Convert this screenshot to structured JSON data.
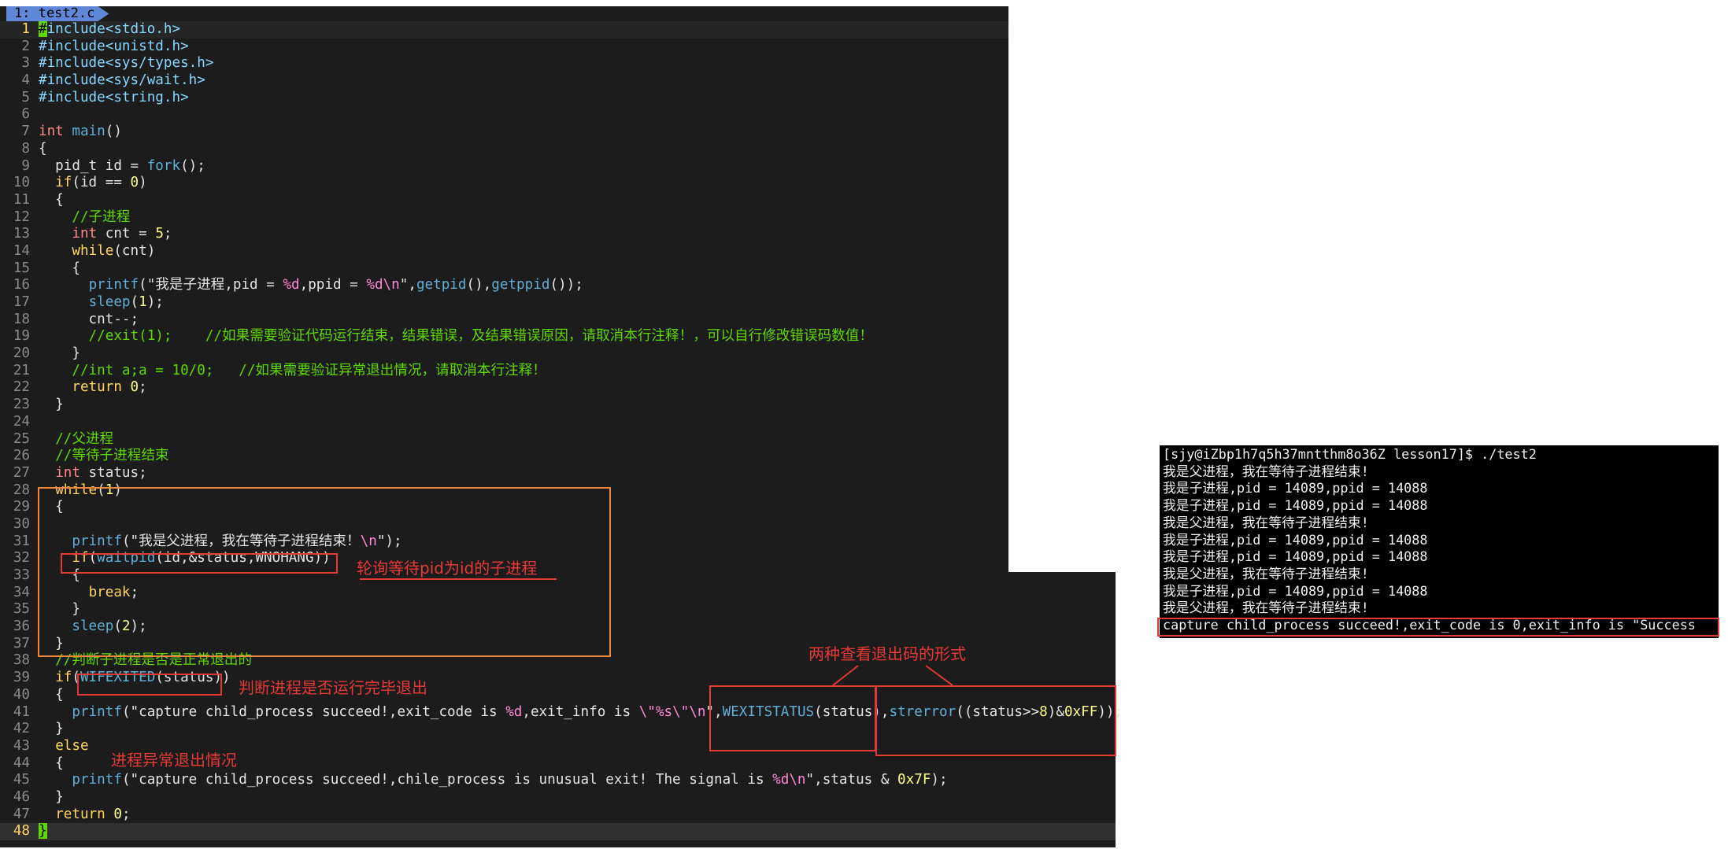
{
  "tab": {
    "label": "1: test2.c"
  },
  "editor": {
    "lines": [
      {
        "n": "1",
        "html": "<span class=\"cursor\">#</span><span class=\"pp\">include&lt;stdio.h&gt;</span>"
      },
      {
        "n": "2",
        "html": "<span class=\"pp\">#include&lt;unistd.h&gt;</span>"
      },
      {
        "n": "3",
        "html": "<span class=\"pp\">#include&lt;sys/types.h&gt;</span>"
      },
      {
        "n": "4",
        "html": "<span class=\"pp\">#include&lt;sys/wait.h&gt;</span>"
      },
      {
        "n": "5",
        "html": "<span class=\"pp\">#include&lt;string.h&gt;</span>"
      },
      {
        "n": "6",
        "html": ""
      },
      {
        "n": "7",
        "html": "<span class=\"ty\">int</span> <span class=\"fn\">main</span>()"
      },
      {
        "n": "8",
        "html": "{"
      },
      {
        "n": "9",
        "html": "  pid_t id = <span class=\"fn\">fork</span>();"
      },
      {
        "n": "10",
        "html": "  <span class=\"kw\">if</span>(id == <span class=\"num\">0</span>)"
      },
      {
        "n": "11",
        "html": "  {"
      },
      {
        "n": "12",
        "html": "    <span class=\"cm\">//子进程</span>"
      },
      {
        "n": "13",
        "html": "    <span class=\"ty\">int</span> cnt = <span class=\"num\">5</span>;"
      },
      {
        "n": "14",
        "html": "    <span class=\"kw\">while</span>(cnt)"
      },
      {
        "n": "15",
        "html": "    {"
      },
      {
        "n": "16",
        "html": "      <span class=\"fn\">printf</span>(\"我是子进程,pid = <span class=\"esc\">%d</span>,ppid = <span class=\"esc\">%d\\n</span>\",<span class=\"fn\">getpid</span>(),<span class=\"fn\">getppid</span>());"
      },
      {
        "n": "17",
        "html": "      <span class=\"fn\">sleep</span>(<span class=\"num\">1</span>);"
      },
      {
        "n": "18",
        "html": "      cnt--;"
      },
      {
        "n": "19",
        "html": "      <span class=\"cm\">//exit(1);    //如果需要验证代码运行结束，结果错误，及结果错误原因，请取消本行注释！，可以自行修改错误码数值！</span>"
      },
      {
        "n": "20",
        "html": "    }"
      },
      {
        "n": "21",
        "html": "    <span class=\"cm\">//int a;a = 10/0;   //如果需要验证异常退出情况，请取消本行注释！</span>"
      },
      {
        "n": "22",
        "html": "    <span class=\"kw\">return</span> <span class=\"num\">0</span>;"
      },
      {
        "n": "23",
        "html": "  }"
      },
      {
        "n": "24",
        "html": ""
      },
      {
        "n": "25",
        "html": "  <span class=\"cm\">//父进程</span>"
      },
      {
        "n": "26",
        "html": "  <span class=\"cm\">//等待子进程结束</span>"
      },
      {
        "n": "27",
        "html": "  <span class=\"ty\">int</span> status;"
      },
      {
        "n": "28",
        "html": "  <span class=\"kw\">while</span>(<span class=\"num\">1</span>)"
      },
      {
        "n": "29",
        "html": "  {"
      },
      {
        "n": "30",
        "html": ""
      },
      {
        "n": "31",
        "html": "    <span class=\"fn\">printf</span>(\"我是父进程，我在等待子进程结束！<span class=\"esc\">\\n</span>\");"
      },
      {
        "n": "32",
        "html": "    <span class=\"kw\">if</span>(<span class=\"fn\">waitpid</span>(id,&amp;status,WNOHANG))"
      },
      {
        "n": "33",
        "html": "    {"
      },
      {
        "n": "34",
        "html": "      <span class=\"kw\">break</span>;"
      },
      {
        "n": "35",
        "html": "    }"
      },
      {
        "n": "36",
        "html": "    <span class=\"fn\">sleep</span>(<span class=\"num\">2</span>);"
      },
      {
        "n": "37",
        "html": "  }"
      },
      {
        "n": "38",
        "html": "  <span class=\"cm\">//判断子进程是否是正常退出的</span>"
      },
      {
        "n": "39",
        "html": "  <span class=\"kw\">if</span>(<span class=\"fn\">WIFEXITED</span>(status))"
      },
      {
        "n": "40",
        "html": "  {"
      },
      {
        "n": "41",
        "html": "    <span class=\"fn\">printf</span>(\"capture child_process succeed!,exit_code is <span class=\"esc\">%d</span>,exit_info is <span class=\"esc\">\\\"</span><span class=\"esc\">%s</span><span class=\"esc\">\\\"</span><span class=\"esc\">\\n</span>\",<span class=\"fn\">WEXITSTATUS</span>(status),<span class=\"fn\">strerror</span>((status&gt;&gt;<span class=\"num\">8</span>)&amp;<span class=\"num\">0xFF</span>));"
      },
      {
        "n": "42",
        "html": "  }"
      },
      {
        "n": "43",
        "html": "  <span class=\"kw\">else</span>"
      },
      {
        "n": "44",
        "html": "  {"
      },
      {
        "n": "45",
        "html": "    <span class=\"fn\">printf</span>(\"capture child_process succeed!,chile_process is unusual exit! The signal is <span class=\"esc\">%d\\n</span>\",status &amp; <span class=\"num\">0x7F</span>);"
      },
      {
        "n": "46",
        "html": "  }"
      },
      {
        "n": "47",
        "html": "  <span class=\"kw\">return</span> <span class=\"num\">0</span>;"
      },
      {
        "n": "48",
        "html": "<span class=\"cursor\">}</span>"
      }
    ]
  },
  "annotations": {
    "poll": "轮询等待pid为id的子进程",
    "wifexited": "判断进程是否运行完毕退出",
    "two_ways": "两种查看退出码的形式",
    "abnormal": "进程异常退出情况"
  },
  "terminal": {
    "lines": [
      "[sjy@iZbp1h7q5h37mntthm8o36Z lesson17]$ ./test2",
      "我是父进程，我在等待子进程结束!",
      "我是子进程,pid = 14089,ppid = 14088",
      "我是子进程,pid = 14089,ppid = 14088",
      "我是父进程，我在等待子进程结束!",
      "我是子进程,pid = 14089,ppid = 14088",
      "我是子进程,pid = 14089,ppid = 14088",
      "我是父进程，我在等待子进程结束!",
      "我是子进程,pid = 14089,ppid = 14088",
      "我是父进程，我在等待子进程结束!",
      "capture child_process succeed!,exit_code is 0,exit_info is \"Success"
    ]
  }
}
